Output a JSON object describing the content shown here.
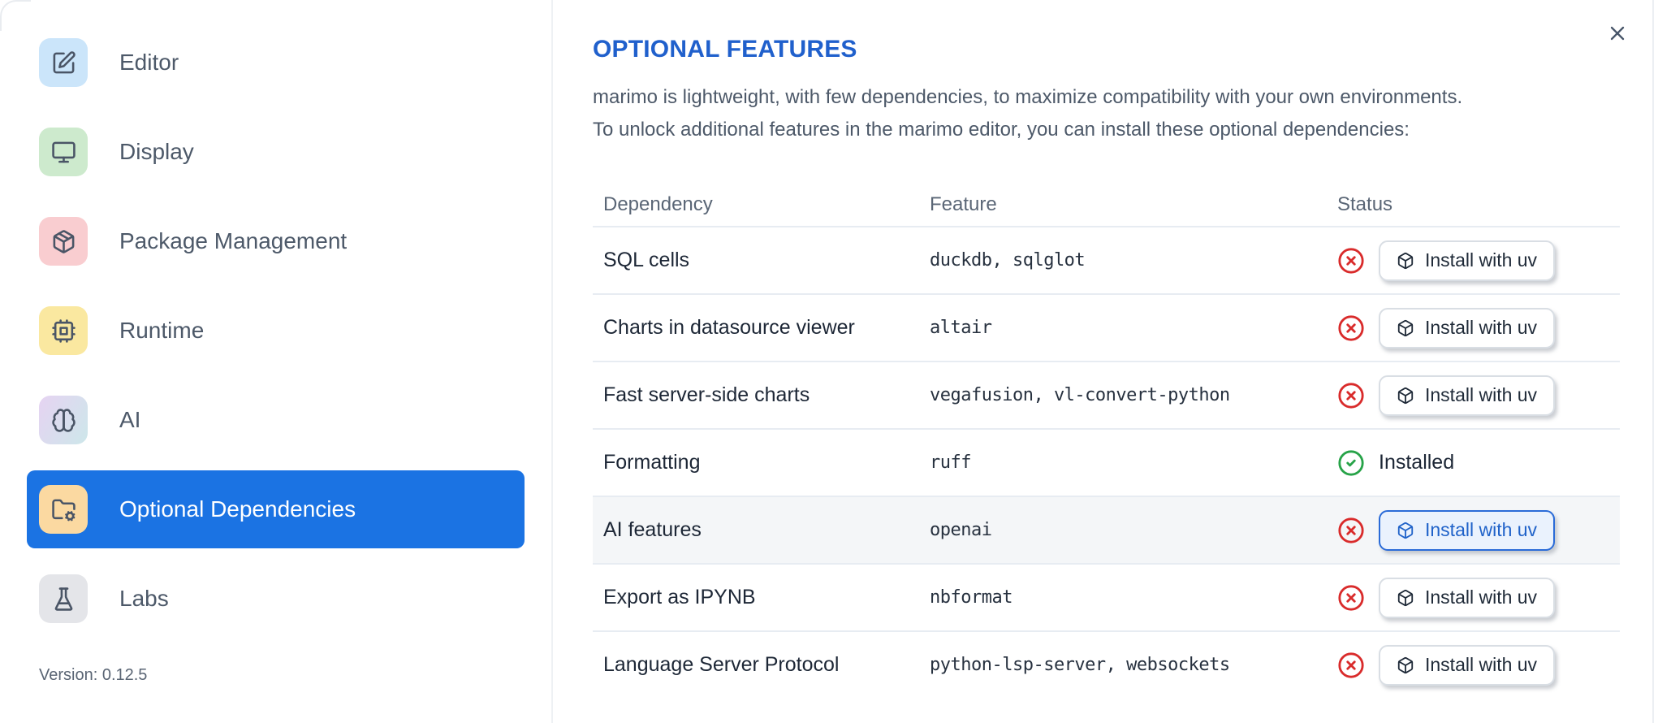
{
  "sidebar": {
    "items": [
      {
        "label": "Editor",
        "icon": "editor-icon",
        "icon_bg": "#cbe5fa",
        "selected": false
      },
      {
        "label": "Display",
        "icon": "display-icon",
        "icon_bg": "#cdeacd",
        "selected": false
      },
      {
        "label": "Package Management",
        "icon": "package-icon",
        "icon_bg": "#f9cdd0",
        "selected": false
      },
      {
        "label": "Runtime",
        "icon": "runtime-icon",
        "icon_bg": "#fae8a0",
        "selected": false
      },
      {
        "label": "AI",
        "icon": "ai-icon",
        "icon_bg": "linear-gradient(120deg,#e6d3f2 0%,#cde7ea 100%)",
        "selected": false
      },
      {
        "label": "Optional Dependencies",
        "icon": "folder-cog-icon",
        "icon_bg": "#fbd9a1",
        "selected": true
      },
      {
        "label": "Labs",
        "icon": "labs-flask-icon",
        "icon_bg": "#e4e5e9",
        "selected": false
      }
    ],
    "version": "Version: 0.12.5"
  },
  "panel": {
    "title": "OPTIONAL FEATURES",
    "description_lines": [
      "marimo is lightweight, with few dependencies, to maximize compatibility with your own environments.",
      "To unlock additional features in the marimo editor, you can install these optional dependencies:"
    ],
    "close_icon": "close-icon"
  },
  "table": {
    "headers": [
      "Dependency",
      "Feature",
      "Status"
    ],
    "rows": [
      {
        "dependency": "SQL cells",
        "feature": "duckdb, sqlglot",
        "status": "missing",
        "action": "Install with uv",
        "highlighted": false
      },
      {
        "dependency": "Charts in datasource viewer",
        "feature": "altair",
        "status": "missing",
        "action": "Install with uv",
        "highlighted": false
      },
      {
        "dependency": "Fast server-side charts",
        "feature": "vegafusion, vl-convert-python",
        "status": "missing",
        "action": "Install with uv",
        "highlighted": false
      },
      {
        "dependency": "Formatting",
        "feature": "ruff",
        "status": "installed",
        "status_label": "Installed",
        "highlighted": false
      },
      {
        "dependency": "AI features",
        "feature": "openai",
        "status": "missing",
        "action": "Install with uv",
        "highlighted": true
      },
      {
        "dependency": "Export as IPYNB",
        "feature": "nbformat",
        "status": "missing",
        "action": "Install with uv",
        "highlighted": false
      },
      {
        "dependency": "Language Server Protocol",
        "feature": "python-lsp-server, websockets",
        "status": "missing",
        "action": "Install with uv",
        "highlighted": false
      }
    ]
  },
  "colors": {
    "accent_blue": "#1b73e3",
    "heading_blue": "#2060cc",
    "error_red": "#d92b2b",
    "success_green": "#27a348",
    "focused_button_bg": "#eaf2fd",
    "focused_button_border": "#2a6bd8",
    "row_highlight": "#f4f6f8"
  }
}
